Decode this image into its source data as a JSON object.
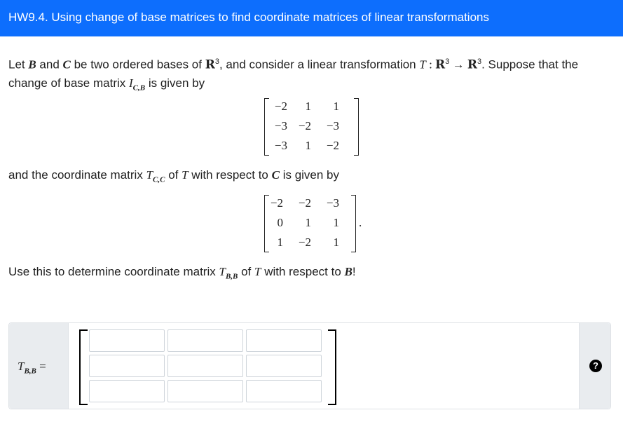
{
  "header": {
    "title": "HW9.4. Using change of base matrices to find coordinate matrices of linear transformations"
  },
  "question": {
    "p1": {
      "t1": "Let ",
      "B": "B",
      "t2": " and ",
      "C": "C",
      "t3": " be two ordered bases of ",
      "R1": "R",
      "exp1": "3",
      "t4": ", and consider a linear transformation ",
      "T": "T",
      "colon": " : ",
      "R2": "R",
      "exp2": "3",
      "arrow": " → ",
      "R3": "R",
      "exp3": "3",
      "t5": ". Suppose that the",
      "line2": "change of base matrix ",
      "I": "I",
      "Isub": "C,B",
      "t6": " is given by"
    },
    "matrix1": [
      "−2",
      "1",
      "1",
      "−3",
      "−2",
      "−3",
      "−3",
      "1",
      "−2"
    ],
    "p2": {
      "t1": "and the coordinate matrix ",
      "T": "T",
      "Tsub": "C,C",
      "t2": " of ",
      "T2": "T",
      "t3": " with respect to ",
      "C": "C",
      "t4": " is given by"
    },
    "matrix2": [
      "−2",
      "−2",
      "−3",
      "0",
      "1",
      "1",
      "1",
      "−2",
      "1"
    ],
    "matrix2_period": ".",
    "p3": {
      "t1": "Use this to determine coordinate matrix ",
      "T": "T",
      "Tsub": "B,B",
      "t2": " of ",
      "T2": "T",
      "t3": " with respect to ",
      "B": "B",
      "t4": "!"
    }
  },
  "answer": {
    "label_T": "T",
    "label_sub": "B,B",
    "label_eq": " =",
    "cells": [
      "",
      "",
      "",
      "",
      "",
      "",
      "",
      "",
      ""
    ],
    "help_symbol": "?"
  }
}
